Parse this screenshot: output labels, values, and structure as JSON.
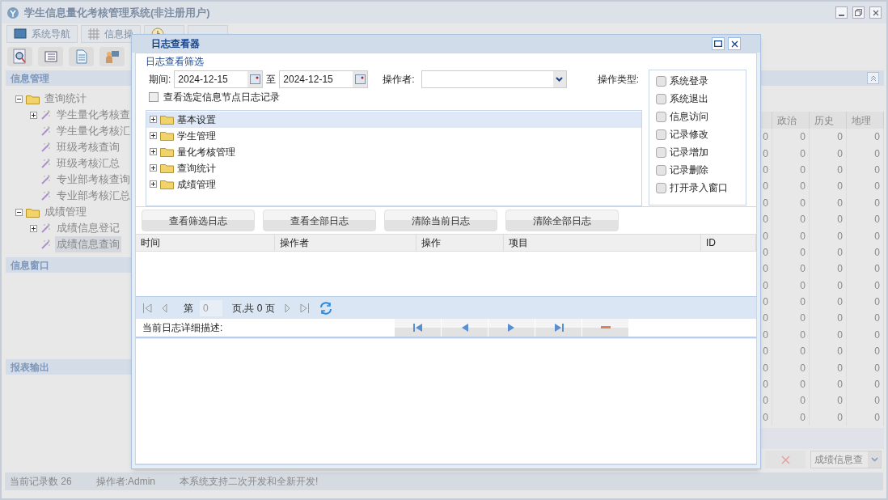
{
  "window": {
    "title": "学生信息量化考核管理系统(非注册用户)"
  },
  "tabs": [
    {
      "label": "系统导航",
      "kind": "monitor"
    },
    {
      "label": "信息操",
      "kind": "grid"
    },
    {
      "kind": "clock"
    },
    {
      "kind": "blank"
    }
  ],
  "toolbar": [
    {
      "kind": "search"
    },
    {
      "kind": "list"
    },
    {
      "kind": "document"
    },
    {
      "kind": "user"
    }
  ],
  "sidebar": {
    "panels": [
      {
        "title": "信息管理",
        "tree": [
          {
            "label": "查询统计",
            "expanded": true,
            "selected": false,
            "children": [
              {
                "label": "学生量化考核查",
                "expanded": false,
                "selected": false
              },
              {
                "label": "学生量化考核汇",
                "selected": false
              },
              {
                "label": "班级考核查询",
                "selected": false
              },
              {
                "label": "班级考核汇总",
                "selected": false
              },
              {
                "label": "专业部考核查询",
                "selected": false
              },
              {
                "label": "专业部考核汇总",
                "selected": false
              }
            ]
          },
          {
            "label": "成绩管理",
            "expanded": true,
            "selected": false,
            "children": [
              {
                "label": "成绩信息登记",
                "expanded": false,
                "selected": false
              },
              {
                "label": "成绩信息查询",
                "selected": true
              }
            ]
          }
        ]
      },
      {
        "title": "信息窗口"
      },
      {
        "title": "报表输出"
      }
    ]
  },
  "grid": {
    "columns": [
      "政治",
      "历史",
      "地理"
    ],
    "rows": [
      [
        "0",
        "0",
        "0",
        "0"
      ],
      [
        "0",
        "0",
        "0",
        "0"
      ],
      [
        "0",
        "0",
        "0",
        "0"
      ],
      [
        "0",
        "0",
        "0",
        "0"
      ],
      [
        "0",
        "0",
        "0",
        "0"
      ],
      [
        "0",
        "0",
        "0",
        "0"
      ],
      [
        "0",
        "0",
        "0",
        "0"
      ],
      [
        "0",
        "0",
        "0",
        "0"
      ],
      [
        "0",
        "0",
        "0",
        "0"
      ],
      [
        "0",
        "0",
        "0",
        "0"
      ],
      [
        "0",
        "0",
        "0",
        "0"
      ],
      [
        "0",
        "0",
        "0",
        "0"
      ],
      [
        "0",
        "0",
        "0",
        "0"
      ],
      [
        "0",
        "0",
        "0",
        "0"
      ],
      [
        "0",
        "0",
        "0",
        "0"
      ],
      [
        "0",
        "0",
        "0",
        "0"
      ],
      [
        "0",
        "0",
        "0",
        "0"
      ],
      [
        "0",
        "0",
        "0",
        "0"
      ]
    ],
    "query_select": {
      "value": "成绩信息查"
    }
  },
  "status_bar": [
    "当前记录数 26",
    "操作者:Admin",
    "本系统支持二次开发和全新开发!"
  ],
  "dialog": {
    "title": "日志查看器",
    "filter": {
      "legend": "日志查看筛选",
      "period_label": "期间:",
      "from": "2024-12-15",
      "to_label": "至",
      "to": "2024-12-15",
      "operator_label": "操作者:",
      "type_label": "操作类型:",
      "node_only": {
        "label": "查看选定信息节点日志记录",
        "checked": false
      },
      "tree": [
        {
          "label": "基本设置",
          "expanded": false,
          "selected": true
        },
        {
          "label": "学生管理",
          "expanded": false,
          "selected": false
        },
        {
          "label": "量化考核管理",
          "expanded": false,
          "selected": false
        },
        {
          "label": "查询统计",
          "expanded": false,
          "selected": false
        },
        {
          "label": "成绩管理",
          "expanded": false,
          "selected": false
        }
      ],
      "types": [
        {
          "label": "系统登录",
          "checked": false
        },
        {
          "label": "系统退出",
          "checked": false
        },
        {
          "label": "信息访问",
          "checked": false
        },
        {
          "label": "记录修改",
          "checked": false
        },
        {
          "label": "记录增加",
          "checked": false
        },
        {
          "label": "记录删除",
          "checked": false
        },
        {
          "label": "打开录入窗口",
          "checked": false
        }
      ]
    },
    "buttons": [
      "查看筛选日志",
      "查看全部日志",
      "清除当前日志",
      "清除全部日志"
    ],
    "log_table": {
      "columns": [
        "时间",
        "操作者",
        "操作",
        "项目",
        "ID"
      ]
    },
    "pager": {
      "page_prefix": "第",
      "page": "0",
      "page_suffix": "页,共 0 页"
    },
    "detail": {
      "label": "当前日志详细描述:",
      "nav": [
        {
          "kind": "first"
        },
        {
          "kind": "prev"
        },
        {
          "kind": "next"
        },
        {
          "kind": "last"
        },
        {
          "kind": "remove"
        }
      ]
    }
  }
}
